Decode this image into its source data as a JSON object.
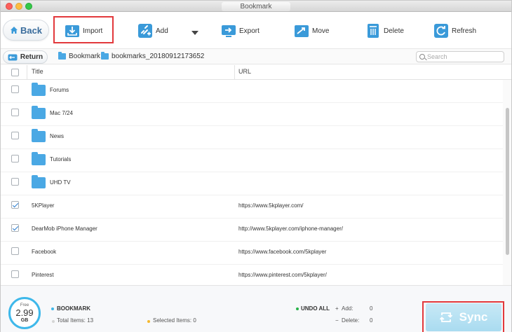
{
  "window": {
    "title": "Bookmark"
  },
  "toolbar": {
    "back_label": "Back",
    "tools": [
      {
        "id": "import",
        "label": "Import",
        "icon": "import-icon"
      },
      {
        "id": "add",
        "label": "Add",
        "icon": "add-link-icon"
      },
      {
        "id": "export",
        "label": "Export",
        "icon": "export-icon"
      },
      {
        "id": "move",
        "label": "Move",
        "icon": "move-icon"
      },
      {
        "id": "delete",
        "label": "Delete",
        "icon": "trash-icon"
      },
      {
        "id": "refresh",
        "label": "Refresh",
        "icon": "refresh-icon"
      }
    ]
  },
  "pathbar": {
    "return_label": "Return",
    "breadcrumb": [
      "Bookmark",
      "bookmarks_20180912173652"
    ],
    "search_placeholder": "Search"
  },
  "table": {
    "columns": [
      "Title",
      "URL"
    ],
    "rows": [
      {
        "title": "Forums",
        "url": "",
        "is_folder": true,
        "checked": false
      },
      {
        "title": "Mac 7/24",
        "url": "",
        "is_folder": true,
        "checked": false
      },
      {
        "title": "News",
        "url": "",
        "is_folder": true,
        "checked": false
      },
      {
        "title": "Tutorials",
        "url": "",
        "is_folder": true,
        "checked": false
      },
      {
        "title": "UHD TV",
        "url": "",
        "is_folder": true,
        "checked": false
      },
      {
        "title": "5KPlayer",
        "url": "https://www.5kplayer.com/",
        "is_folder": false,
        "checked": true
      },
      {
        "title": "DearMob iPhone Manager",
        "url": "http://www.5kplayer.com/iphone-manager/",
        "is_folder": false,
        "checked": true
      },
      {
        "title": "Facebook",
        "url": "https://www.facebook.com/5kplayer",
        "is_folder": false,
        "checked": false
      },
      {
        "title": "Pinterest",
        "url": "https://www.pinterest.com/5kplayer/",
        "is_folder": false,
        "checked": false
      }
    ]
  },
  "footer": {
    "storage": {
      "free_label": "Free",
      "value": "2.99",
      "unit": "GB"
    },
    "section_label": "BOOKMARK",
    "total_items_label": "Total Items: 13",
    "selected_items_label": "Selected Items: 0",
    "undo_all_label": "UNDO ALL",
    "add_label": "Add:",
    "add_count": "0",
    "delete_label": "Delete:",
    "delete_count": "0",
    "sync_label": "Sync",
    "colors": {
      "accent": "#3eb8ea",
      "selected_dot": "#f5b82e",
      "undo_dot": "#29b34a"
    }
  }
}
